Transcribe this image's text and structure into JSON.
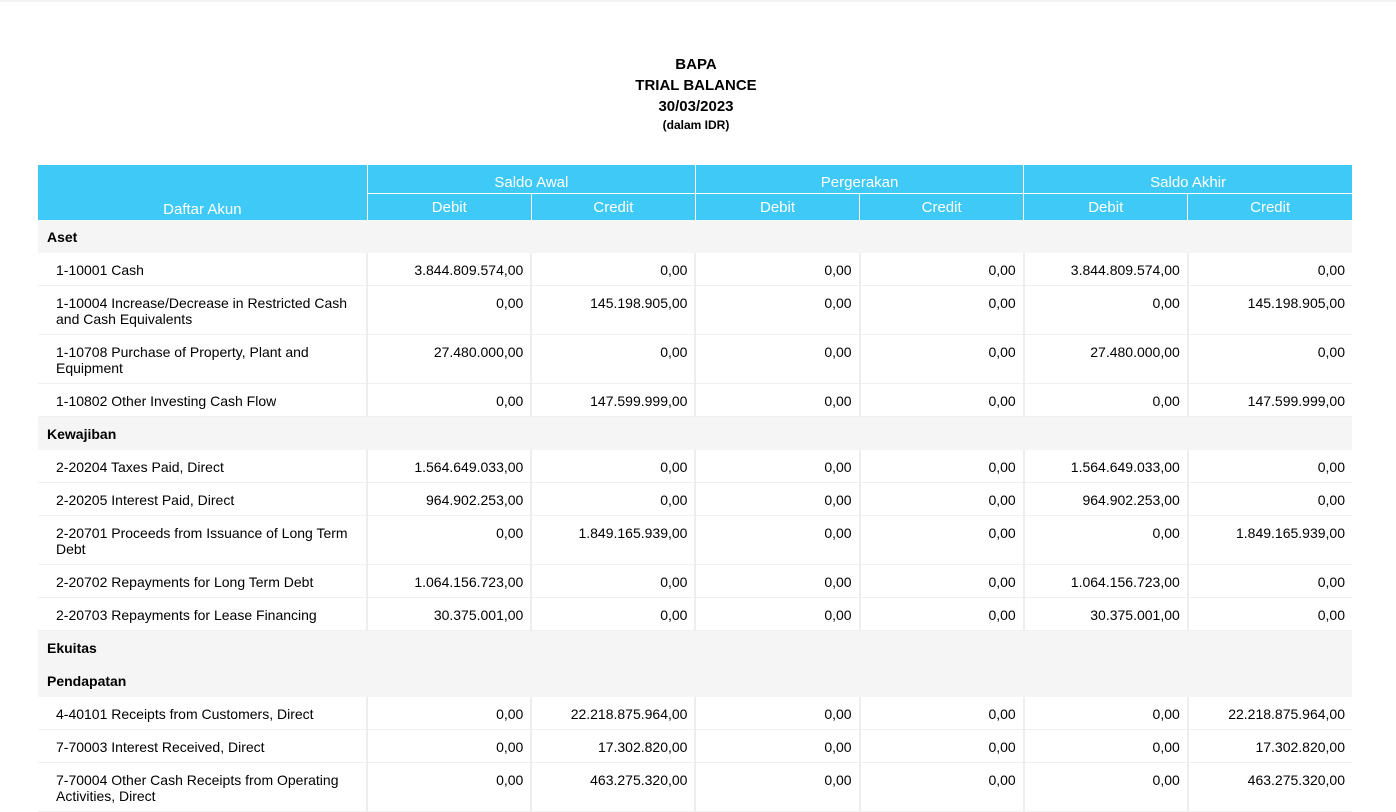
{
  "report": {
    "company": "BAPA",
    "title": "TRIAL BALANCE",
    "date": "30/03/2023",
    "currency_note": "(dalam IDR)"
  },
  "columns": {
    "account_header": "Daftar Akun",
    "groups": [
      "Saldo Awal",
      "Pergerakan",
      "Saldo Akhir"
    ],
    "debit_label": "Debit",
    "credit_label": "Credit"
  },
  "colors": {
    "header_bg": "#3ec9f7",
    "group_row_bg": "#f5f5f5"
  },
  "sections": [
    {
      "name": "Aset",
      "rows": [
        {
          "account": "1-10001 Cash",
          "values": [
            "3.844.809.574,00",
            "0,00",
            "0,00",
            "0,00",
            "3.844.809.574,00",
            "0,00"
          ]
        },
        {
          "account": "1-10004 Increase/Decrease in Restricted Cash and Cash Equivalents",
          "values": [
            "0,00",
            "145.198.905,00",
            "0,00",
            "0,00",
            "0,00",
            "145.198.905,00"
          ]
        },
        {
          "account": "1-10708 Purchase of Property, Plant and Equipment",
          "values": [
            "27.480.000,00",
            "0,00",
            "0,00",
            "0,00",
            "27.480.000,00",
            "0,00"
          ]
        },
        {
          "account": "1-10802 Other Investing Cash Flow",
          "values": [
            "0,00",
            "147.599.999,00",
            "0,00",
            "0,00",
            "0,00",
            "147.599.999,00"
          ]
        }
      ]
    },
    {
      "name": "Kewajiban",
      "rows": [
        {
          "account": "2-20204 Taxes Paid, Direct",
          "values": [
            "1.564.649.033,00",
            "0,00",
            "0,00",
            "0,00",
            "1.564.649.033,00",
            "0,00"
          ]
        },
        {
          "account": "2-20205 Interest Paid, Direct",
          "values": [
            "964.902.253,00",
            "0,00",
            "0,00",
            "0,00",
            "964.902.253,00",
            "0,00"
          ]
        },
        {
          "account": "2-20701 Proceeds from Issuance of Long Term Debt",
          "values": [
            "0,00",
            "1.849.165.939,00",
            "0,00",
            "0,00",
            "0,00",
            "1.849.165.939,00"
          ]
        },
        {
          "account": "2-20702 Repayments for Long Term Debt",
          "values": [
            "1.064.156.723,00",
            "0,00",
            "0,00",
            "0,00",
            "1.064.156.723,00",
            "0,00"
          ]
        },
        {
          "account": "2-20703 Repayments for Lease Financing",
          "values": [
            "30.375.001,00",
            "0,00",
            "0,00",
            "0,00",
            "30.375.001,00",
            "0,00"
          ]
        }
      ]
    },
    {
      "name": "Ekuitas",
      "rows": []
    },
    {
      "name": "Pendapatan",
      "rows": [
        {
          "account": "4-40101 Receipts from Customers, Direct",
          "values": [
            "0,00",
            "22.218.875.964,00",
            "0,00",
            "0,00",
            "0,00",
            "22.218.875.964,00"
          ]
        },
        {
          "account": "7-70003 Interest Received, Direct",
          "values": [
            "0,00",
            "17.302.820,00",
            "0,00",
            "0,00",
            "0,00",
            "17.302.820,00"
          ]
        },
        {
          "account": "7-70004 Other Cash Receipts from Operating Activities, Direct",
          "values": [
            "0,00",
            "463.275.320,00",
            "0,00",
            "0,00",
            "0,00",
            "463.275.320,00"
          ]
        }
      ]
    }
  ]
}
